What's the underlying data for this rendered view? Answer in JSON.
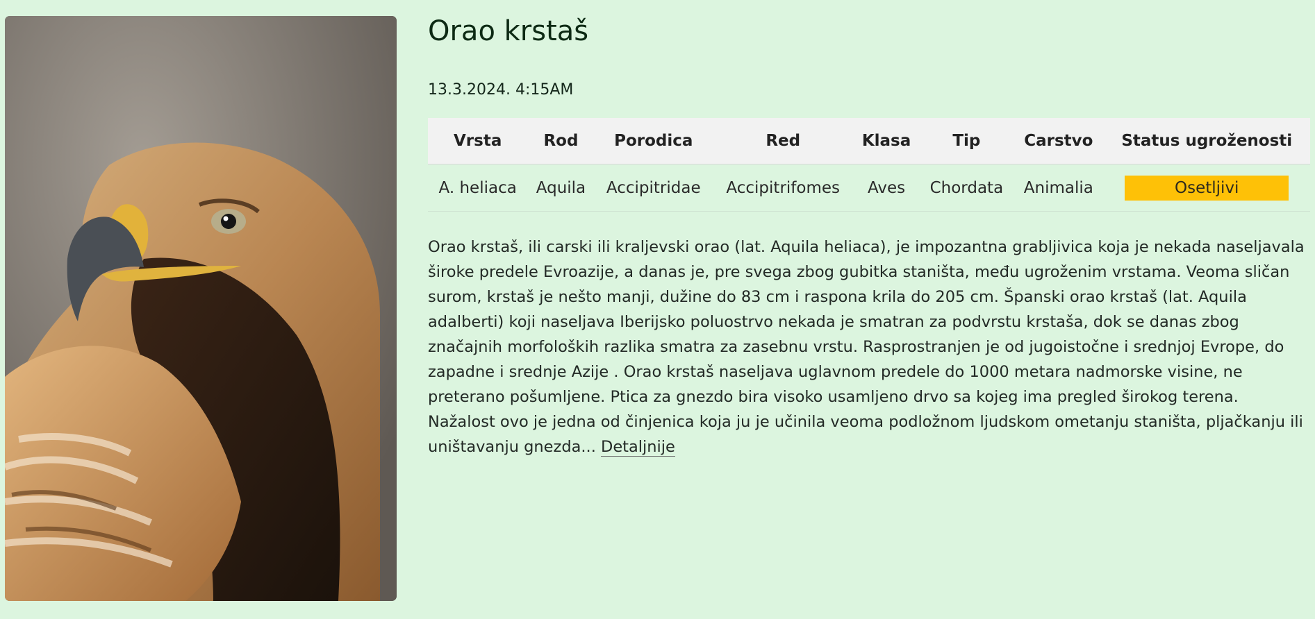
{
  "photo": {
    "icon": "golden-eagle-photo"
  },
  "title": "Orao krstaš",
  "date": "13.3.2024. 4:15AM",
  "table": {
    "headers": [
      "Vrsta",
      "Rod",
      "Porodica",
      "Red",
      "Klasa",
      "Tip",
      "Carstvo",
      "Status ugroženosti"
    ],
    "row": [
      "A. heliaca",
      "Aquila",
      "Accipitridae",
      "Accipitrifomes",
      "Aves",
      "Chordata",
      "Animalia",
      "Osetljivi"
    ]
  },
  "description": "Orao krstaš, ili carski ili kraljevski orao (lat. Aquila heliaca), je impozantna grabljivica koja je nekada naseljavala široke predele Evroazije, a danas je, pre svega zbog gubitka staništa, među ugroženim vrstama. Veoma sličan surom, krstaš je nešto manji, dužine do 83 cm i raspona krila do 205 cm. Španski orao krstaš (lat. Aquila adalberti) koji naseljava Iberijsko poluostrvo nekada je smatran za podvrstu krstaša, dok se danas zbog značajnih morfoloških razlika smatra za zasebnu vrstu. Rasprostranjen je od jugoistočne i srednjoj Evrope, do zapadne i srednje Azije . Orao krstaš naseljava uglavnom predele do 1000 metara nadmorske visine, ne preterano pošumljene. Ptica za gnezdo bira visoko usamljeno drvo sa kojeg ima pregled širokog terena. Nažalost ovo je jedna od činjenica koja ju je učinila veoma podložnom ljudskom ometanju staništa, pljačkanju ili uništavanju gnezda...",
  "more_link": "Detaljnije",
  "colors": {
    "background": "#dcf5df",
    "status_badge": "#fec107",
    "table_header": "#f2f2f2"
  }
}
